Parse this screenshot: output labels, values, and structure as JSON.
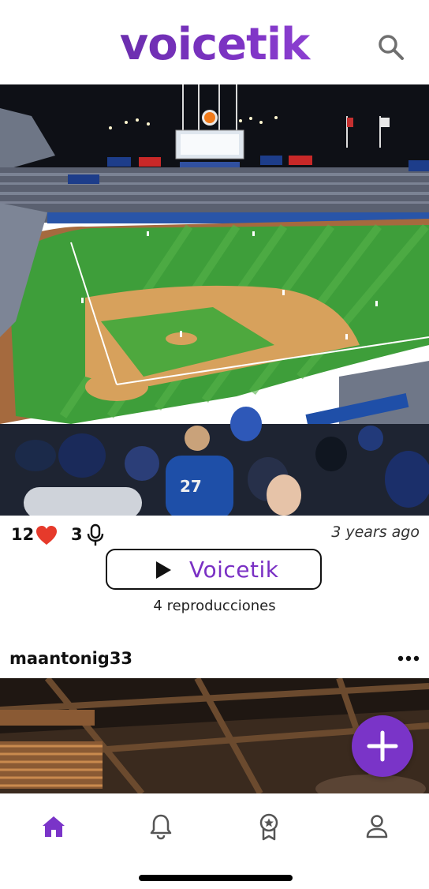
{
  "app": {
    "name": "voicetik",
    "brand_color": "#7a34c8"
  },
  "header": {
    "logo": "voicetik",
    "search_icon": "search-icon"
  },
  "post": {
    "image_desc_icon": "stadium-photo",
    "likes": "12",
    "voices": "3",
    "time_ago": "3 years ago",
    "play_label": "Voicetik",
    "plays": "4 reproducciones"
  },
  "next_post": {
    "username": "maantonig33"
  },
  "fab": {
    "icon": "plus-icon"
  },
  "nav": {
    "items": [
      "home-icon",
      "bell-icon",
      "badge-icon",
      "user-icon"
    ],
    "active": "home-icon",
    "active_color": "#7a34c8",
    "inactive_color": "#555555"
  }
}
